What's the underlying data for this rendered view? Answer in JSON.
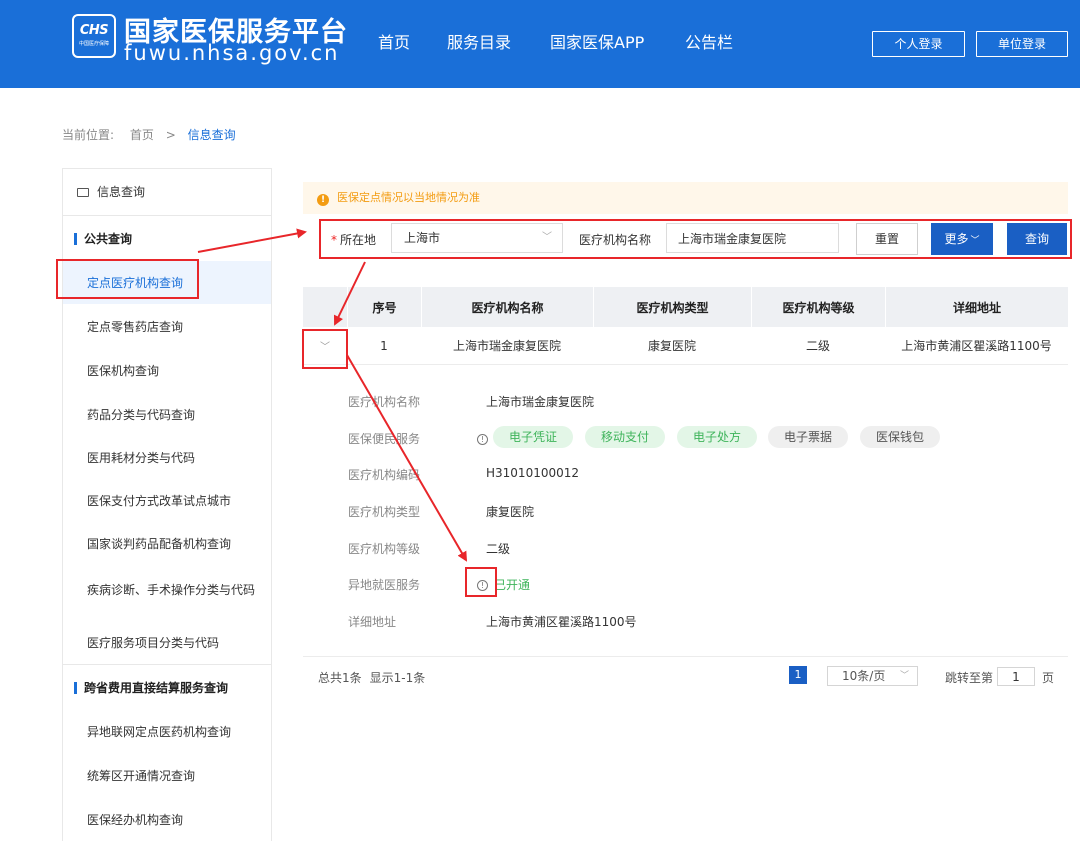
{
  "header": {
    "logo_mark": "CHS",
    "logo_sub": "中国医疗保障",
    "title": "国家医保服务平台",
    "url": "fuwu.nhsa.gov.cn",
    "nav": [
      "首页",
      "服务目录",
      "国家医保APP",
      "公告栏"
    ],
    "personal_login": "个人登录",
    "org_login": "单位登录"
  },
  "breadcrumb": {
    "label": "当前位置:",
    "home": "首页",
    "sep": ">",
    "current": "信息查询"
  },
  "sidebar": {
    "title": "信息查询",
    "group1": "公共查询",
    "group1_items": [
      "定点医疗机构查询",
      "定点零售药店查询",
      "医保机构查询",
      "药品分类与代码查询",
      "医用耗材分类与代码",
      "医保支付方式改革试点城市",
      "国家谈判药品配备机构查询",
      "疾病诊断、手术操作分类与代码",
      "医疗服务项目分类与代码"
    ],
    "group2": "跨省费用直接结算服务查询",
    "group2_items": [
      "异地联网定点医药机构查询",
      "统筹区开通情况查询",
      "医保经办机构查询"
    ]
  },
  "notice": "医保定点情况以当地情况为准",
  "filter": {
    "location_label": "所在地",
    "location_value": "上海市",
    "name_label": "医疗机构名称",
    "name_value": "上海市瑞金康复医院",
    "reset": "重置",
    "more": "更多",
    "query": "查询"
  },
  "table": {
    "headers": [
      "序号",
      "医疗机构名称",
      "医疗机构类型",
      "医疗机构等级",
      "详细地址"
    ],
    "rows": [
      [
        "1",
        "上海市瑞金康复医院",
        "康复医院",
        "二级",
        "上海市黄浦区瞿溪路1100号"
      ]
    ]
  },
  "details": {
    "name_label": "医疗机构名称",
    "name_value": "上海市瑞金康复医院",
    "service_label": "医保便民服务",
    "services": [
      {
        "label": "电子凭证",
        "enabled": true
      },
      {
        "label": "移动支付",
        "enabled": true
      },
      {
        "label": "电子处方",
        "enabled": true
      },
      {
        "label": "电子票据",
        "enabled": false
      },
      {
        "label": "医保钱包",
        "enabled": false
      }
    ],
    "code_label": "医疗机构编码",
    "code_value": "H31010100012",
    "type_label": "医疗机构类型",
    "type_value": "康复医院",
    "level_label": "医疗机构等级",
    "level_value": "二级",
    "remote_label": "异地就医服务",
    "remote_value": "已开通",
    "address_label": "详细地址",
    "address_value": "上海市黄浦区瞿溪路1100号"
  },
  "pagination": {
    "total": "总共1条",
    "shown": "显示1-1条",
    "current_page": "1",
    "page_size": "10条/页",
    "jump_label": "跳转至第",
    "jump_value": "1",
    "jump_suffix": "页"
  },
  "colors": {
    "brand": "#1a6fd8",
    "button": "#1a5fc4",
    "notice": "#f39c12",
    "enabled": "#3fb45b",
    "annotation": "#e8262a"
  }
}
